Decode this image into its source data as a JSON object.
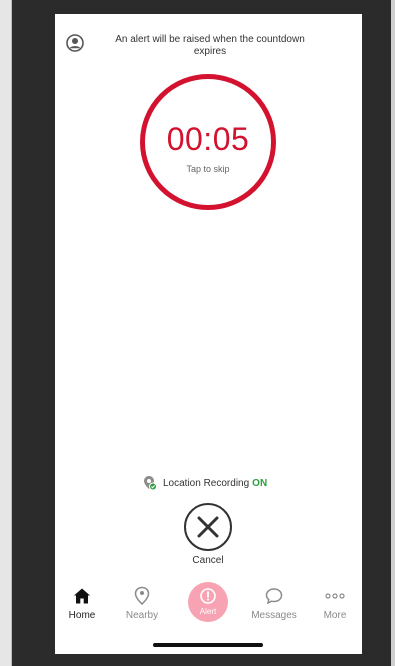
{
  "header": {
    "message": "An alert will be raised when the countdown expires"
  },
  "countdown": {
    "time": "00:05",
    "hint": "Tap to skip"
  },
  "location": {
    "label": "Location Recording",
    "status": "ON"
  },
  "cancel": {
    "label": "Cancel"
  },
  "tabbar": {
    "items": [
      {
        "label": "Home",
        "icon": "home-icon",
        "active": true
      },
      {
        "label": "Nearby",
        "icon": "location-pin-icon",
        "active": false
      },
      {
        "label": "Alert",
        "icon": "alert-icon",
        "active": false
      },
      {
        "label": "Messages",
        "icon": "chat-bubble-icon",
        "active": false
      },
      {
        "label": "More",
        "icon": "more-dots-icon",
        "active": false
      }
    ]
  },
  "colors": {
    "accent": "#d3122f",
    "alert_tab": "#f7a3b3",
    "status_on": "#2e9b3c"
  }
}
